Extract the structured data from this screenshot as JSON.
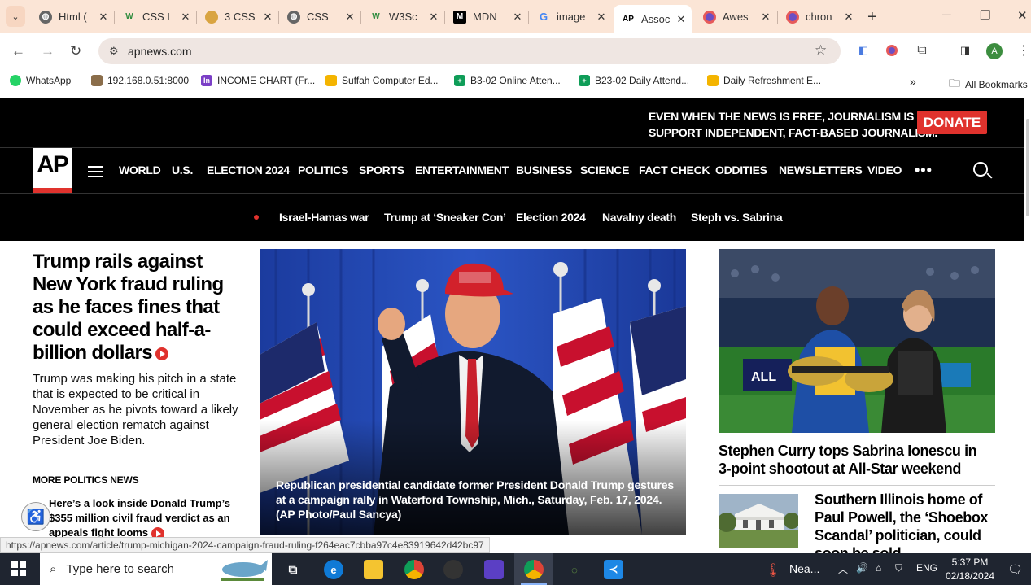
{
  "browser": {
    "tabs": [
      {
        "title": "Html (",
        "icon": "globe-icon"
      },
      {
        "title": "CSS L",
        "icon": "w3schools-icon"
      },
      {
        "title": "3 CSS",
        "icon": "chrome-ext-icon"
      },
      {
        "title": "CSS",
        "icon": "globe-icon"
      },
      {
        "title": "W3Sc",
        "icon": "w3schools-icon"
      },
      {
        "title": "MDN",
        "icon": "mdn-icon"
      },
      {
        "title": "image",
        "icon": "google-icon"
      },
      {
        "title": "Assoc",
        "icon": "ap-icon",
        "active": true
      },
      {
        "title": "Awes",
        "icon": "chrome-ext-icon"
      },
      {
        "title": "chron",
        "icon": "chrome-ext-icon"
      }
    ],
    "url": "apnews.com",
    "profile_initial": "A",
    "bookmarks": [
      {
        "label": "WhatsApp"
      },
      {
        "label": "192.168.0.51:8000"
      },
      {
        "label": "INCOME CHART (Fr..."
      },
      {
        "label": "Suffah Computer Ed..."
      },
      {
        "label": "B3-02 Online Atten..."
      },
      {
        "label": "B23-02 Daily Attend..."
      },
      {
        "label": "Daily Refreshment E..."
      }
    ],
    "bookmarks_overflow": "»",
    "all_bookmarks": "All Bookmarks",
    "status_url": "https://apnews.com/article/trump-michigan-2024-campaign-fraud-ruling-f264eac7cbba97c4e83919642d42bc97"
  },
  "site": {
    "donate_line1": "EVEN WHEN THE NEWS IS FREE, JOURNALISM IS NOT.",
    "donate_line2": "SUPPORT INDEPENDENT, FACT-BASED JOURNALISM.",
    "donate_button": "DONATE",
    "logo": "AP",
    "nav": [
      "WORLD",
      "U.S.",
      "ELECTION 2024",
      "POLITICS",
      "SPORTS",
      "ENTERTAINMENT",
      "BUSINESS",
      "SCIENCE",
      "FACT CHECK",
      "ODDITIES",
      "NEWSLETTERS",
      "VIDEO"
    ],
    "nav_more": "•••",
    "trending": [
      "Israel-Hamas war",
      "Trump at ‘Sneaker Con’",
      "Election 2024",
      "Navalny death",
      "Steph vs. Sabrina"
    ],
    "lead_headline": "Trump rails against New York fraud ruling as he faces fines that could exceed half-a-billion dollars",
    "lead_summary": "Trump was making his pitch in a state that is expected to be critical in November as he pivots toward a likely general election rematch against President Joe Biden.",
    "more_politics": "MORE POLITICS NEWS",
    "related_headline": "Here’s a look inside Donald Trump’s $355 million civil fraud verdict as an appeals fight looms",
    "hero_caption": "Republican presidential candidate former President Donald Trump gestures at a campaign rally in Waterford Township, Mich., Saturday, Feb. 17, 2024. (AP Photo/Paul Sancya)",
    "side_headline": "Stephen Curry tops Sabrina Ionescu in 3-point shootout at All-Star weekend",
    "side2_headline": "Southern Illinois home of Paul Powell, the ‘Shoebox Scandal’ politician, could soon be sold"
  },
  "taskbar": {
    "search_placeholder": "Type here to search",
    "weather": "Nea...",
    "lang": "ENG",
    "time": "5:37 PM",
    "date": "02/18/2024"
  },
  "colors": {
    "ap_red": "#e0322d",
    "tab_strip": "#fbe5d6",
    "taskbar": "#1f2530"
  }
}
